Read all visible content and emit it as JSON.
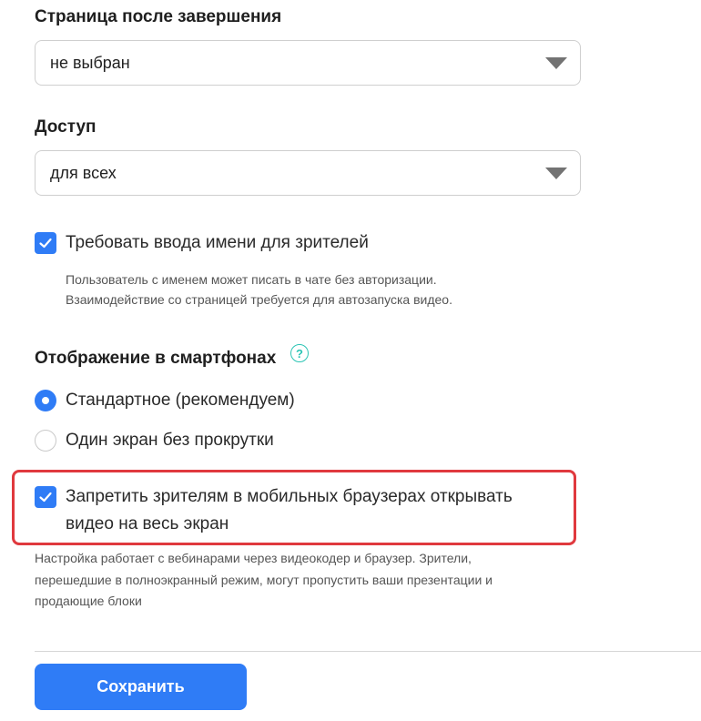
{
  "finish_page": {
    "title": "Страница после завершения",
    "selected": "не выбран"
  },
  "access": {
    "title": "Доступ",
    "selected": "для всех"
  },
  "require_name": {
    "label": "Требовать ввода имени для зрителей",
    "checked": true,
    "hint_line1": "Пользователь с именем может писать в чате без авторизации.",
    "hint_line2": "Взаимодействие со страницей требуется для автозапуска видео."
  },
  "mobile_display": {
    "title": "Отображение в смартфонах",
    "help_icon": "?",
    "options": [
      {
        "label": "Стандартное (рекомендуем)",
        "selected": true
      },
      {
        "label": "Один экран без прокрутки",
        "selected": false
      }
    ]
  },
  "block_fullscreen": {
    "label_line1": "Запретить зрителям в мобильных браузерах открывать",
    "label_line2": "видео на весь экран",
    "checked": true,
    "hint_line1": "Настройка работает с вебинарами через видеокодер и браузер. Зрители,",
    "hint_line2": "перешедшие в полноэкранный режим, могут пропустить ваши презентации и",
    "hint_line3": "продающие блоки"
  },
  "save_button": {
    "label": "Сохранить"
  },
  "colors": {
    "accent": "#2f7cf6",
    "highlight": "#e0393e",
    "help": "#2bc4b4"
  }
}
